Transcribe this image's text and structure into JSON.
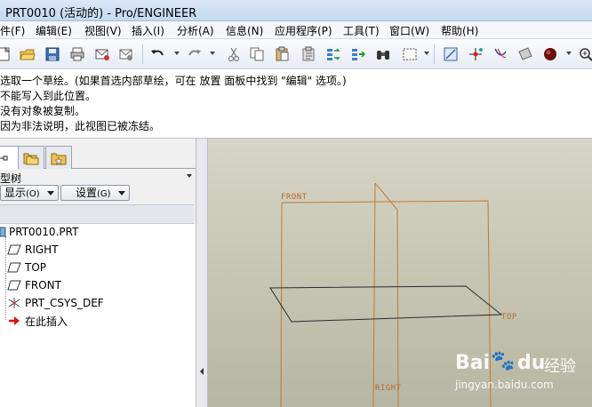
{
  "window": {
    "title": "PRT0010 (活动的) - Pro/ENGINEER"
  },
  "menu": [
    "文件(F)",
    "编辑(E)",
    "视图(V)",
    "插入(I)",
    "分析(A)",
    "信息(N)",
    "应用程序(P)",
    "工具(T)",
    "窗口(W)",
    "帮助(H)"
  ],
  "messages": [
    "选取一个草绘。(如果首选内部草绘，可在 放置 面板中找到 \"编辑\" 选项。)",
    "不能写入到此位置。",
    "没有对象被复制。",
    "因为非法说明，此视图已被冻结。"
  ],
  "panel": {
    "title": "型树",
    "show_label": "显示",
    "show_key": "(O)",
    "settings_label": "设置",
    "settings_key": "(G)"
  },
  "tree": {
    "root": "PRT0010.PRT",
    "items": [
      "RIGHT",
      "TOP",
      "FRONT",
      "PRT_CSYS_DEF",
      "在此插入"
    ]
  },
  "viewport": {
    "labels": {
      "front": "FRONT",
      "top": "TOP",
      "right": "RIGHT"
    }
  },
  "watermark": {
    "brand_a": "Bai",
    "brand_b": "du",
    "brand_c": "经验",
    "url": "jingyan.baidu.com"
  },
  "colors": {
    "plane_edge": "#c07a33",
    "sketch_line": "#2b2b2b",
    "background_top": "#d6d5c6"
  }
}
